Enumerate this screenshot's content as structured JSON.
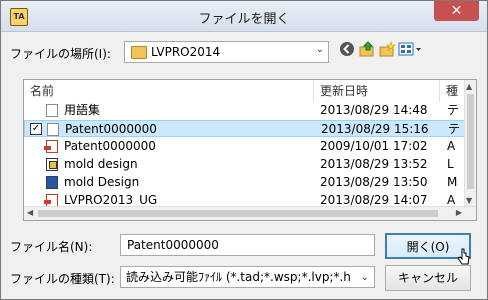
{
  "window": {
    "title": "ファイルを開く",
    "close_glyph": "✕"
  },
  "location": {
    "label": "ファイルの場所(I):",
    "value": "LVPRO2014"
  },
  "toolbar": {
    "back_icon": "back-icon",
    "up_icon": "up-folder-icon",
    "new_folder_icon": "new-folder-icon",
    "view_menu_icon": "view-menu-icon"
  },
  "file_list": {
    "columns": [
      "名前",
      "更新日時",
      "種"
    ],
    "rows": [
      {
        "name": "用語集",
        "modified": "2013/08/29 14:48",
        "type": "テ",
        "icon": "doc",
        "checked": false,
        "selected": false
      },
      {
        "name": "Patent0000000",
        "modified": "2013/08/29 15:16",
        "type": "テ",
        "icon": "doc",
        "checked": true,
        "selected": true
      },
      {
        "name": "Patent0000000",
        "modified": "2009/10/01 17:02",
        "type": "A",
        "icon": "pdf",
        "checked": false,
        "selected": false
      },
      {
        "name": "mold design",
        "modified": "2013/08/29 13:52",
        "type": "L",
        "icon": "cad",
        "checked": false,
        "selected": false
      },
      {
        "name": "mold Design",
        "modified": "2013/08/29 13:50",
        "type": "M",
        "icon": "word",
        "checked": false,
        "selected": false
      },
      {
        "name": "LVPRO2013_UG",
        "modified": "2013/08/29 14:07",
        "type": "A",
        "icon": "pdf",
        "checked": false,
        "selected": false
      }
    ]
  },
  "filename": {
    "label": "ファイル名(N):",
    "value": "Patent0000000"
  },
  "filetype": {
    "label": "ファイルの種類(T):",
    "value": "読み込み可能ﾌｧｲﾙ (*.tad;*.wsp;*.lvp;*.h"
  },
  "buttons": {
    "open": "開く(O)",
    "cancel": "キャンセル"
  },
  "colors": {
    "selection": "#cce8ff",
    "close_button": "#c75050",
    "default_button_border": "#3c7fb1"
  }
}
